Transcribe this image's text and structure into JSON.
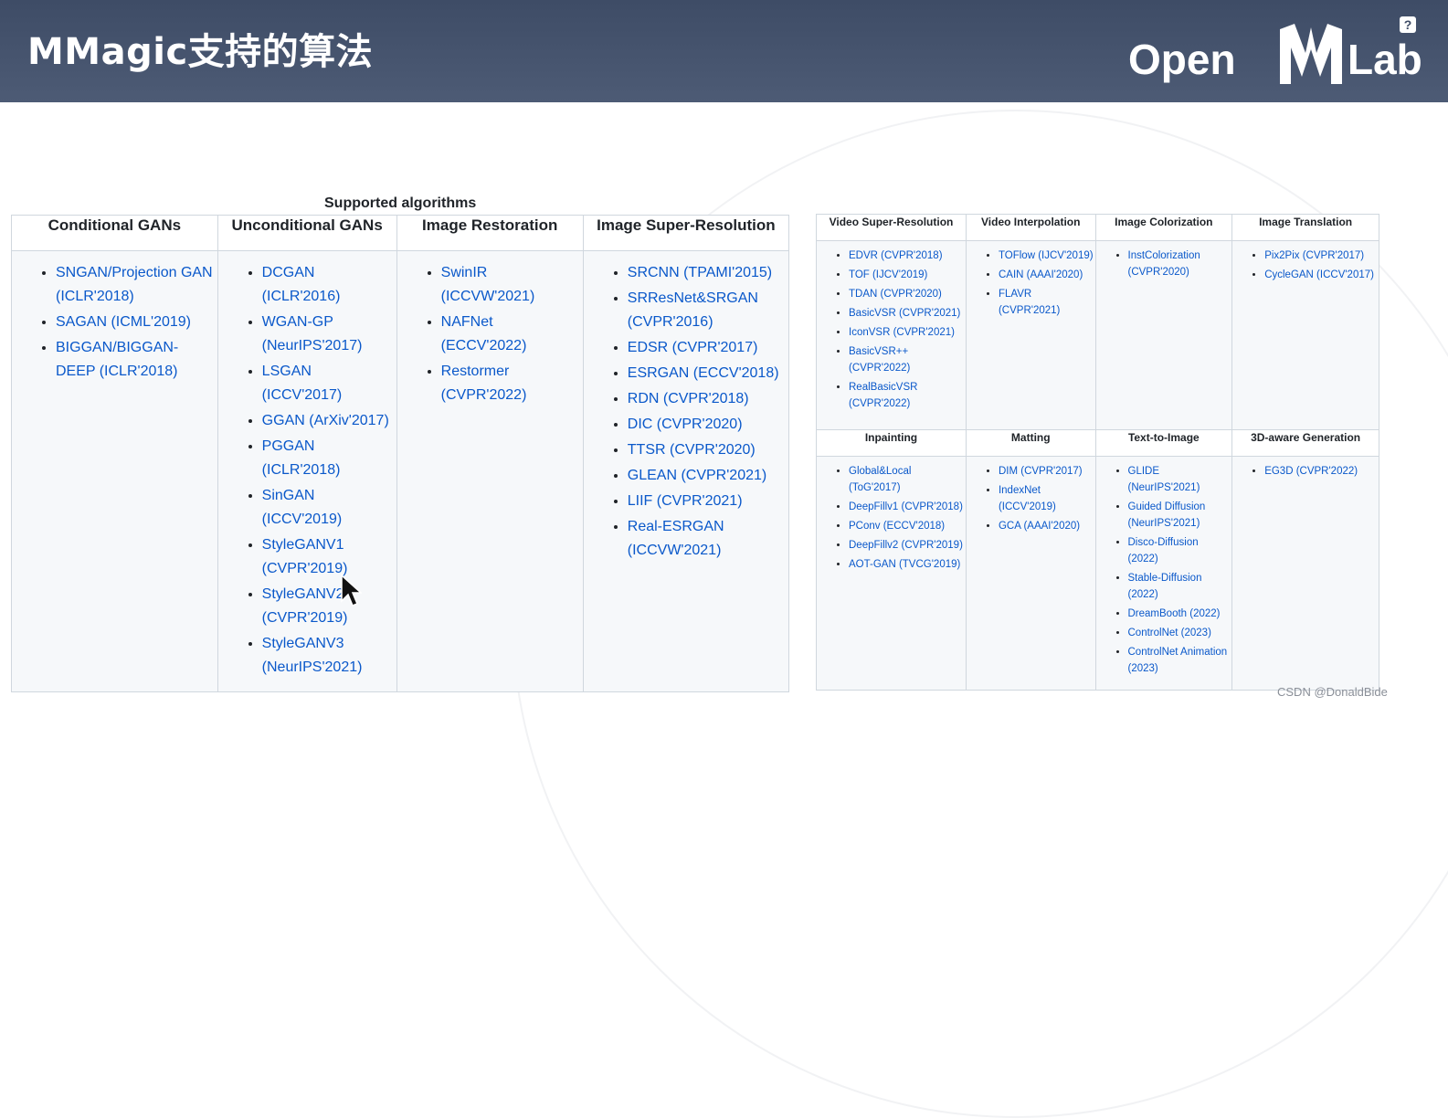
{
  "header": {
    "title": "MMagic支持的算法",
    "logo_left": "Open",
    "logo_right": "Lab",
    "help": "?"
  },
  "caption": "Supported algorithms",
  "table1": {
    "headers": [
      "Conditional GANs",
      "Unconditional GANs",
      "Image Restoration",
      "Image Super-Resolution"
    ],
    "columns": [
      [
        "SNGAN/Projection GAN (ICLR'2018)",
        "SAGAN (ICML'2019)",
        "BIGGAN/BIGGAN-DEEP (ICLR'2018)"
      ],
      [
        "DCGAN (ICLR'2016)",
        "WGAN-GP (NeurIPS'2017)",
        "LSGAN (ICCV'2017)",
        "GGAN (ArXiv'2017)",
        "PGGAN (ICLR'2018)",
        "SinGAN (ICCV'2019)",
        "StyleGANV1 (CVPR'2019)",
        "StyleGANV2 (CVPR'2019)",
        "StyleGANV3 (NeurIPS'2021)"
      ],
      [
        "SwinIR (ICCVW'2021)",
        "NAFNet (ECCV'2022)",
        "Restormer (CVPR'2022)"
      ],
      [
        "SRCNN (TPAMI'2015)",
        "SRResNet&SRGAN (CVPR'2016)",
        "EDSR (CVPR'2017)",
        "ESRGAN (ECCV'2018)",
        "RDN (CVPR'2018)",
        "DIC (CVPR'2020)",
        "TTSR (CVPR'2020)",
        "GLEAN (CVPR'2021)",
        "LIIF (CVPR'2021)",
        "Real-ESRGAN (ICCVW'2021)"
      ]
    ]
  },
  "table2": {
    "headers_row1": [
      "Video Super-Resolution",
      "Video Interpolation",
      "Image Colorization",
      "Image Translation"
    ],
    "row1": [
      [
        "EDVR (CVPR'2018)",
        "TOF (IJCV'2019)",
        "TDAN (CVPR'2020)",
        "BasicVSR (CVPR'2021)",
        "IconVSR (CVPR'2021)",
        "BasicVSR++ (CVPR'2022)",
        "RealBasicVSR (CVPR'2022)"
      ],
      [
        "TOFlow (IJCV'2019)",
        "CAIN (AAAI'2020)",
        "FLAVR (CVPR'2021)"
      ],
      [
        "InstColorization (CVPR'2020)"
      ],
      [
        "Pix2Pix (CVPR'2017)",
        "CycleGAN (ICCV'2017)"
      ]
    ],
    "headers_row2": [
      "Inpainting",
      "Matting",
      "Text-to-Image",
      "3D-aware Generation"
    ],
    "row2": [
      [
        "Global&Local (ToG'2017)",
        "DeepFillv1 (CVPR'2018)",
        "PConv (ECCV'2018)",
        "DeepFillv2 (CVPR'2019)",
        "AOT-GAN (TVCG'2019)"
      ],
      [
        "DIM (CVPR'2017)",
        "IndexNet (ICCV'2019)",
        "GCA (AAAI'2020)"
      ],
      [
        "GLIDE (NeurIPS'2021)",
        "Guided Diffusion (NeurIPS'2021)",
        "Disco-Diffusion (2022)",
        "Stable-Diffusion (2022)",
        "DreamBooth (2022)",
        "ControlNet (2023)",
        "ControlNet Animation (2023)"
      ],
      [
        "EG3D (CVPR'2022)"
      ]
    ]
  },
  "watermark": "CSDN @DonaldBide",
  "icons": {
    "cursor": "mouse-pointer-icon",
    "help": "help-icon"
  }
}
